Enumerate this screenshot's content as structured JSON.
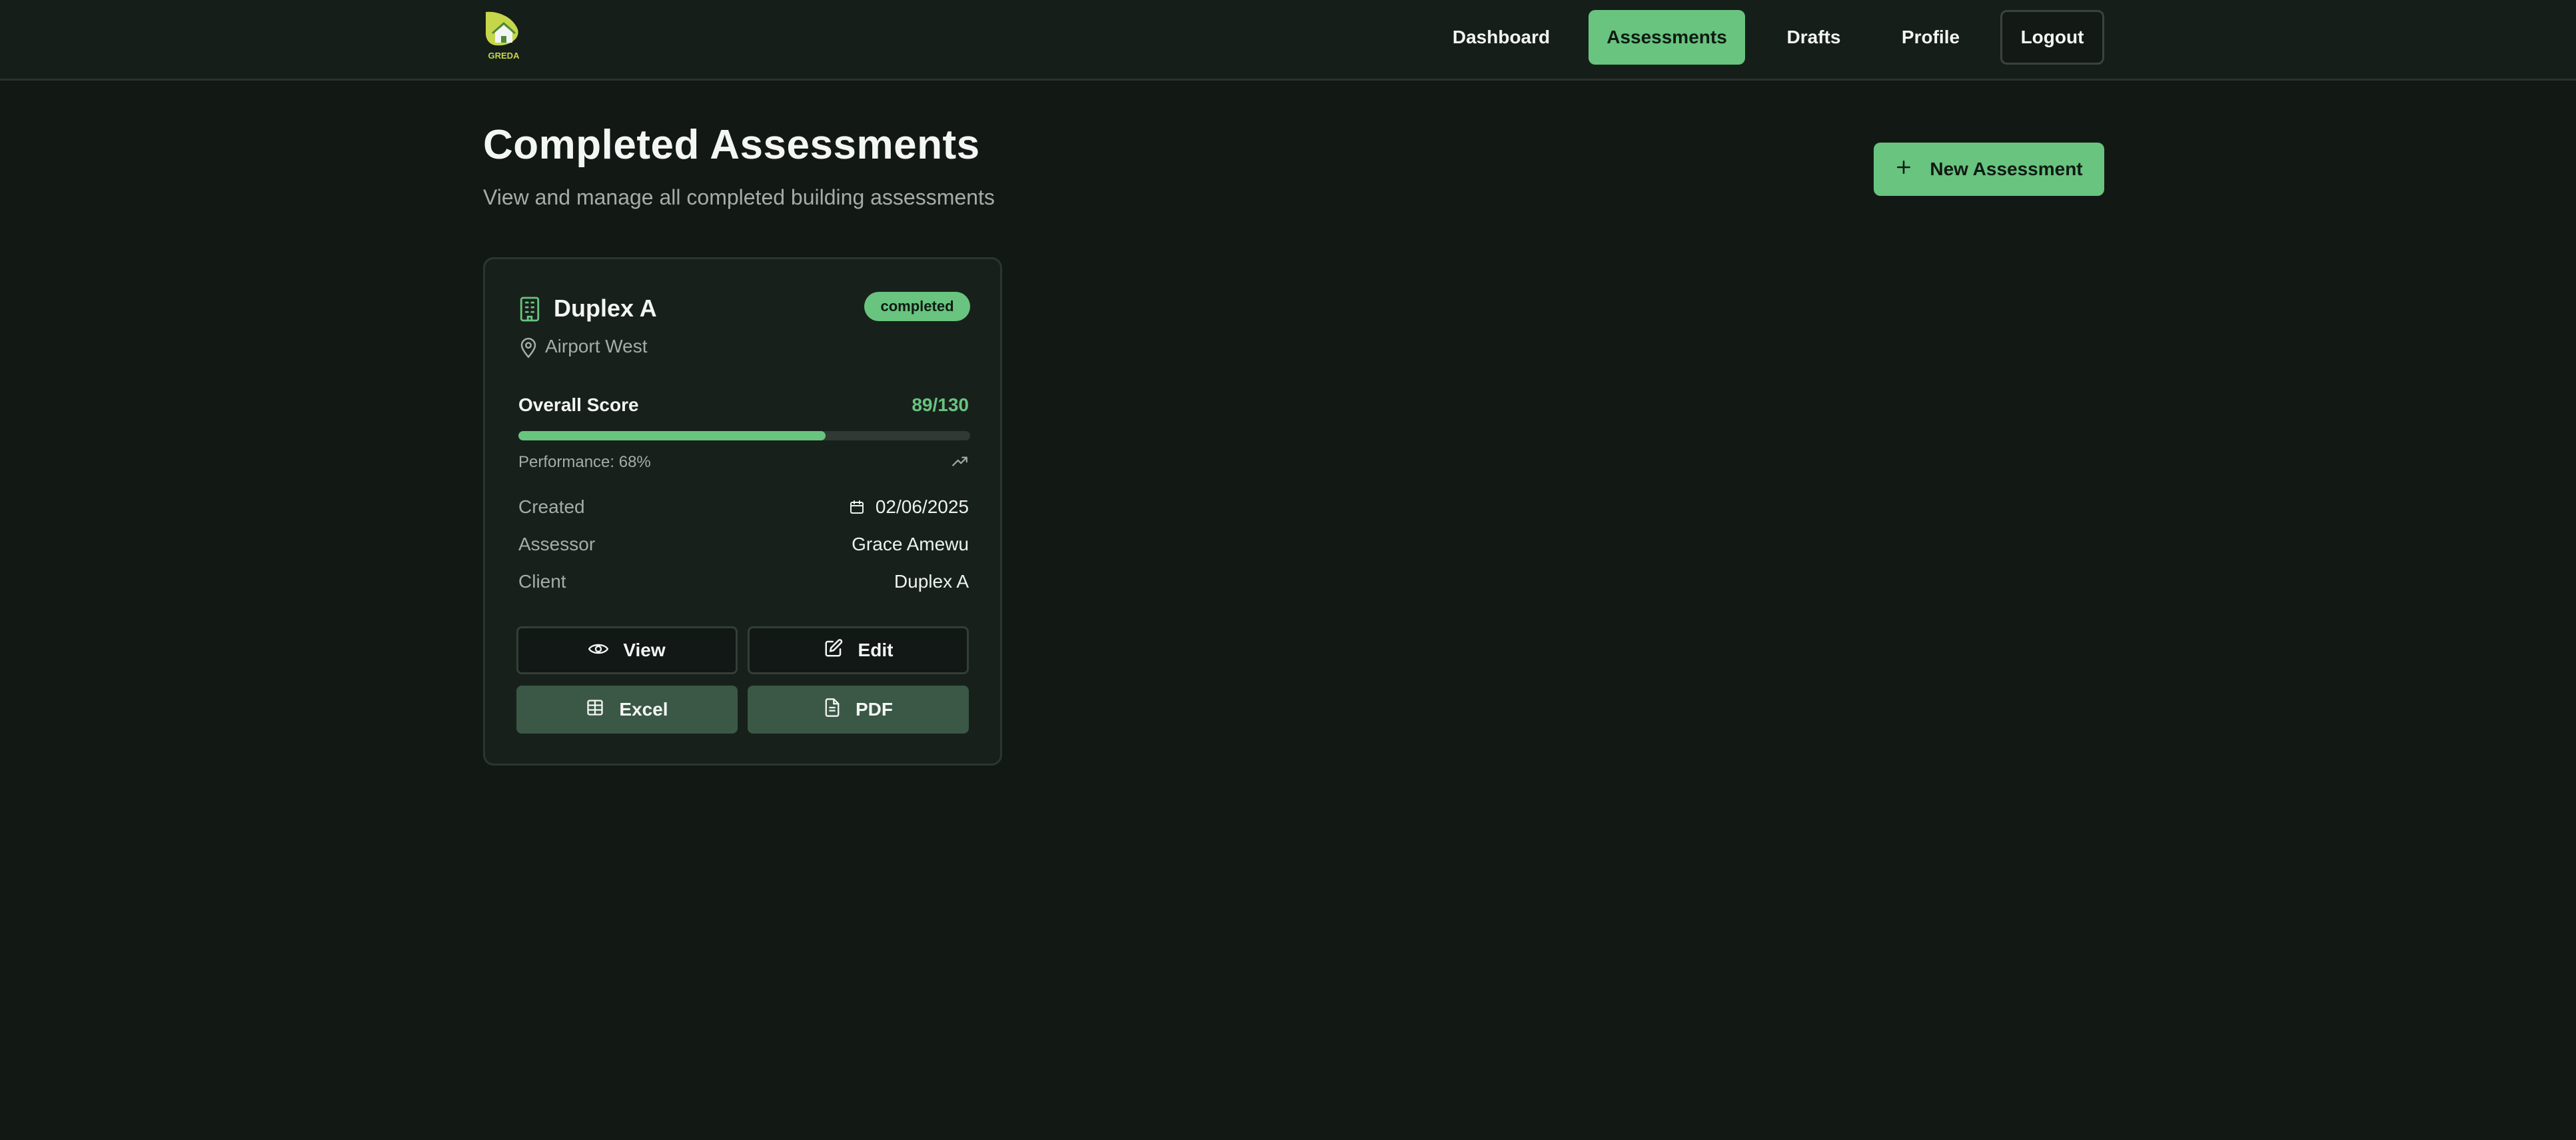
{
  "brand": {
    "logo_text": "GREDA"
  },
  "nav": {
    "dashboard": "Dashboard",
    "assessments": "Assessments",
    "drafts": "Drafts",
    "profile": "Profile",
    "logout": "Logout"
  },
  "page": {
    "title": "Completed Assessments",
    "subtitle": "View and manage all completed building assessments",
    "new_button": "New Assessment"
  },
  "card": {
    "title": "Duplex A",
    "status": "completed",
    "location": "Airport West",
    "score_label": "Overall Score",
    "score_value": "89/130",
    "score_fraction": 0.68,
    "performance": "Performance: 68%",
    "rows": [
      {
        "label": "Created",
        "value": "02/06/2025"
      },
      {
        "label": "Assessor",
        "value": "Grace Amewu"
      },
      {
        "label": "Client",
        "value": "Duplex A"
      }
    ],
    "buttons": {
      "view": "View",
      "edit": "Edit",
      "excel": "Excel",
      "pdf": "PDF"
    }
  },
  "colors": {
    "accent": "#68c47e",
    "background": "#121915",
    "card": "#18201c",
    "filled_button": "#3a5845"
  },
  "icons": [
    "building-icon",
    "map-pin-icon",
    "trending-up-icon",
    "calendar-icon",
    "eye-icon",
    "edit-icon",
    "table-icon",
    "file-text-icon",
    "plus-icon"
  ]
}
